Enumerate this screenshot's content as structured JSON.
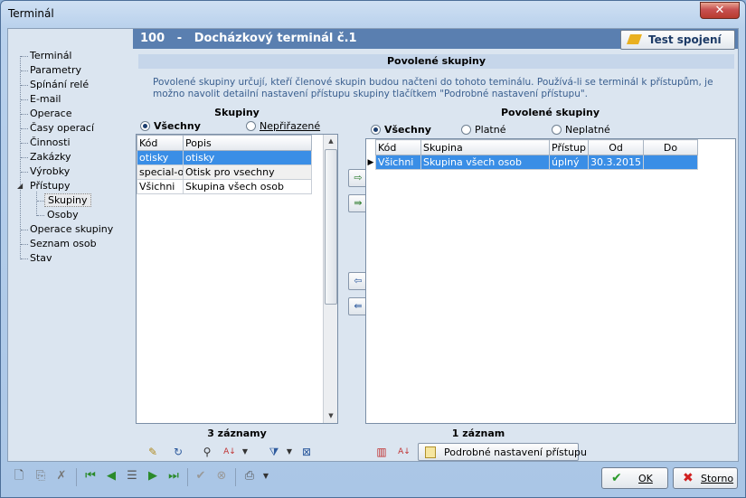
{
  "window": {
    "title": "Terminál",
    "close_glyph": "✕"
  },
  "tree": {
    "items": [
      {
        "label": "Terminál"
      },
      {
        "label": "Parametry"
      },
      {
        "label": "Spínání relé"
      },
      {
        "label": "E-mail"
      },
      {
        "label": "Operace"
      },
      {
        "label": "Časy operací"
      },
      {
        "label": "Činnosti"
      },
      {
        "label": "Zakázky"
      },
      {
        "label": "Výrobky"
      },
      {
        "label": "Přístupy"
      },
      {
        "label": "Skupiny"
      },
      {
        "label": "Osoby"
      },
      {
        "label": "Operace skupiny"
      },
      {
        "label": "Seznam osob"
      },
      {
        "label": "Stav"
      }
    ]
  },
  "header": {
    "number": "100",
    "dash": "-",
    "name": "Docházkový terminál č.1",
    "test_button": "Test spojení"
  },
  "section": {
    "title": "Povolené skupiny",
    "description_line1": "Povolené skupiny určují, kteří členové skupin budou načteni do tohoto teminálu. Používá-li se terminál k přístupům, je",
    "description_line2": "možno navolit detailní nastavení přístupu skupiny tlačítkem \"Podrobné nastavení přístupu\"."
  },
  "left_panel": {
    "title": "Skupiny",
    "radio_all": "Všechny",
    "radio_unassigned": "Nepřiřazené",
    "columns": [
      "Kód",
      "Popis"
    ],
    "rows": [
      {
        "code": "otisky",
        "desc": "otisky"
      },
      {
        "code": "special-ot",
        "desc": "Otisk pro vsechny"
      },
      {
        "code": "Všichni",
        "desc": "Skupina všech osob"
      }
    ],
    "count": "3 záznamy"
  },
  "right_panel": {
    "title": "Povolené skupiny",
    "radio_all": "Všechny",
    "radio_valid": "Platné",
    "radio_invalid": "Neplatné",
    "columns": [
      "Kód",
      "Skupina",
      "Přístup",
      "Od",
      "Do"
    ],
    "rows": [
      {
        "code": "Všichni",
        "group": "Skupina všech osob",
        "access": "úplný",
        "from": "30.3.2015",
        "to": ""
      }
    ],
    "count": "1 záznam",
    "detail_button": "Podrobné nastavení přístupu"
  },
  "buttons": {
    "ok": "OK",
    "cancel": "Storno"
  },
  "colors": {
    "header_bg": "#5a7fb0",
    "selection": "#3a8ee6",
    "panel_bg": "#dbe5f0"
  }
}
